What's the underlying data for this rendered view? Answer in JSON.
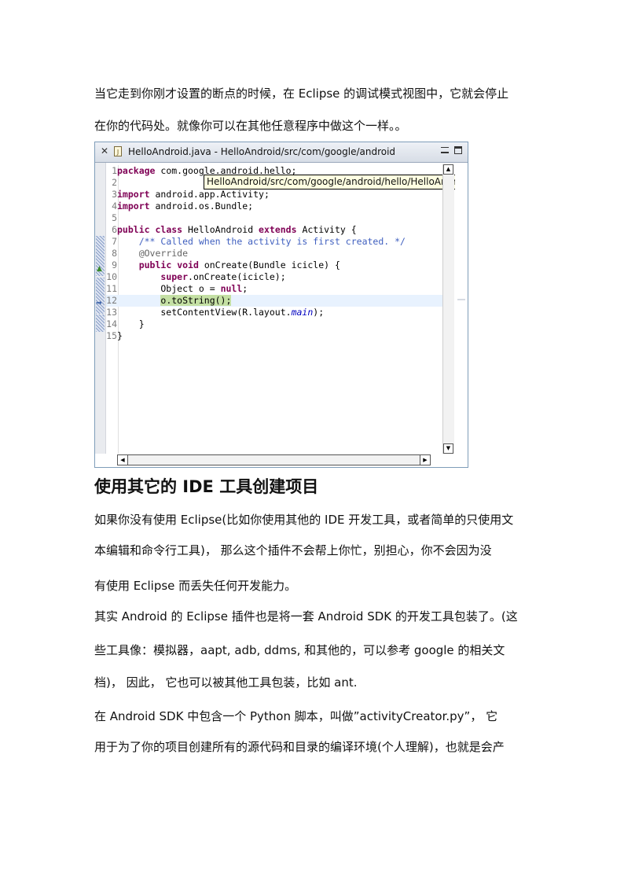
{
  "paragraphs_top": [
    "当它走到你刚才设置的断点的时候，在 Eclipse 的调试模式视图中，它就会停止",
    "在你的代码处。就像你可以在其他任意程序中做这个一样。。"
  ],
  "editor": {
    "tab_title": "HelloAndroid.java - HelloAndroid/src/com/google/android",
    "tooltip": "HelloAndroid/src/com/google/android/hello/HelloAndroid.java",
    "code": [
      {
        "n": "1",
        "html": "<span class=\"kw\">package</span> com.google.android.hello;"
      },
      {
        "n": "2",
        "html": ""
      },
      {
        "n": "3",
        "html": "<span class=\"kw\">import</span> android.app.Activity;"
      },
      {
        "n": "4",
        "html": "<span class=\"kw\">import</span> android.os.Bundle;"
      },
      {
        "n": "5",
        "html": ""
      },
      {
        "n": "6",
        "html": "<span class=\"kw\">public</span> <span class=\"kw\">class</span> HelloAndroid <span class=\"kw\">extends</span> Activity {"
      },
      {
        "n": "7",
        "html": "    <span class=\"cm\">/** Called when the activity is first created. */</span>"
      },
      {
        "n": "8",
        "html": "    <span class=\"an\">@Override</span>"
      },
      {
        "n": "9",
        "html": "    <span class=\"kw\">public</span> <span class=\"kw\">void</span> onCreate(Bundle icicle) {"
      },
      {
        "n": "10",
        "html": "        <span class=\"kw\">super</span>.onCreate(icicle);"
      },
      {
        "n": "11",
        "html": "        Object o = <span class=\"kw\">null</span>;"
      },
      {
        "n": "12",
        "html": "        <span class=\"hl\">o.toString();</span>"
      },
      {
        "n": "13",
        "html": "        setContentView(R.layout.<span class=\"st\">main</span>);"
      },
      {
        "n": "14",
        "html": "    }"
      },
      {
        "n": "15",
        "html": "}"
      }
    ]
  },
  "heading": "使用其它的 IDE 工具创建项目",
  "paragraphs_bottom": [
    "如果你没有使用 Eclipse(比如你使用其他的 IDE 开发工具，或者简单的只使用文",
    "本编辑和命令行工具)，  那么这个插件不会帮上你忙，别担心，你不会因为没",
    "有使用 Eclipse 而丢失任何开发能力。",
    "其实 Android 的 Eclipse 插件也是将一套 Android SDK 的开发工具包装了。(这",
    "些工具像：模拟器，aapt, adb, ddms, 和其他的，可以参考 google 的相关文",
    "档)，  因此，  它也可以被其他工具包装，比如 ant.",
    "在 Android SDK 中包含一个 Python 脚本，叫做”activityCreator.py”，  它",
    "用于为了你的项目创建所有的源代码和目录的编译环境(个人理解)，也就是会产"
  ]
}
